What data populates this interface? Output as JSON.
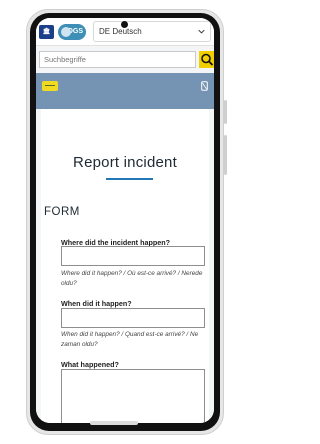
{
  "header": {
    "logo1_text": "🏛",
    "logo2_text": "DGS",
    "language_select": "DE Deutsch"
  },
  "search": {
    "placeholder": "Suchbegriffe"
  },
  "page": {
    "title": "Report incident",
    "form_heading": "FORM"
  },
  "form": {
    "fields": [
      {
        "label": "Where did the incident happen?",
        "hint": "Where did it happen? / Où est-ce arrivé? / Nerede oldu?"
      },
      {
        "label": "When did it happen?",
        "hint": "When did it happen? / Quand est-ce arrivé? / Ne zaman oldu?"
      },
      {
        "label": "What happened?"
      }
    ]
  },
  "colors": {
    "accent": "#2377b5",
    "hero": "#7593b3",
    "search_button": "#f2cf00"
  }
}
